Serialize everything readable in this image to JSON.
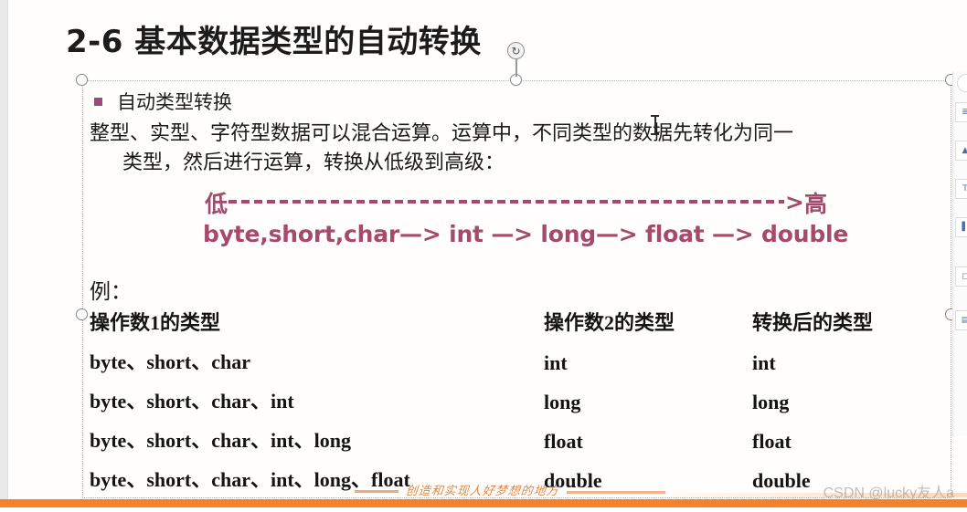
{
  "slide": {
    "title": "2-6 基本数据类型的自动转换",
    "bullet_label": "自动类型转换",
    "paragraph_line1": "整型、实型、字符型数据可以混合运算。运算中，不同类型的数据先转化为同一",
    "paragraph_line2": "类型，然后进行运算，转换从低级到高级：",
    "chain": {
      "low_label": "低",
      "high_label": "高",
      "arrow_head": ">",
      "types_line": "byte,short,char—> int —> long—> float —> double",
      "color": "#a64a6b"
    },
    "example_label": "例：",
    "table": {
      "headers": [
        "操作数1的类型",
        "操作数2的类型",
        "转换后的类型"
      ],
      "rows": [
        [
          "byte、short、char",
          "int",
          "int"
        ],
        [
          "byte、short、char、int",
          "long",
          "long"
        ],
        [
          "byte、short、char、int、long",
          "float",
          "float"
        ],
        [
          "byte、short、char、int、long、float",
          "double",
          "double"
        ]
      ]
    }
  },
  "selection": {
    "rotate_icon": "↻"
  },
  "watermark": {
    "script_text": "创造和实现人好梦想的地方",
    "csdn_tag": "CSDN @lucky友人a",
    "bar_color": "#f5822a"
  },
  "right_toolbar": {
    "buttons": [
      "text-box-icon",
      "picture-icon",
      "wordart-icon",
      "shape-icon",
      "chart-icon",
      "table-icon"
    ],
    "glyphs": [
      "≣",
      "▲",
      "T",
      "▌",
      "◻",
      "▤"
    ]
  }
}
